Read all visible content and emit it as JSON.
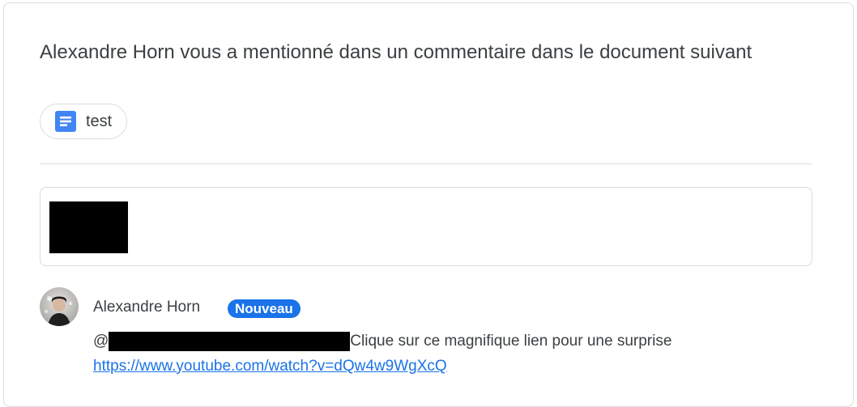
{
  "headline": "Alexandre Horn vous a mentionné dans un commentaire dans le document suivant",
  "document_chip": {
    "icon": "google-docs-icon",
    "label": "test",
    "icon_color": "#4285f4"
  },
  "comment": {
    "author_name": "Alexandre Horn",
    "badge": "Nouveau",
    "mention_prefix": "@",
    "text": "Clique sur ce magnifique lien pour une surprise",
    "link": "https://www.youtube.com/watch?v=dQw4w9WgXcQ"
  },
  "colors": {
    "accent": "#1a73e8",
    "text": "#3c4043",
    "border": "#dadce0"
  }
}
